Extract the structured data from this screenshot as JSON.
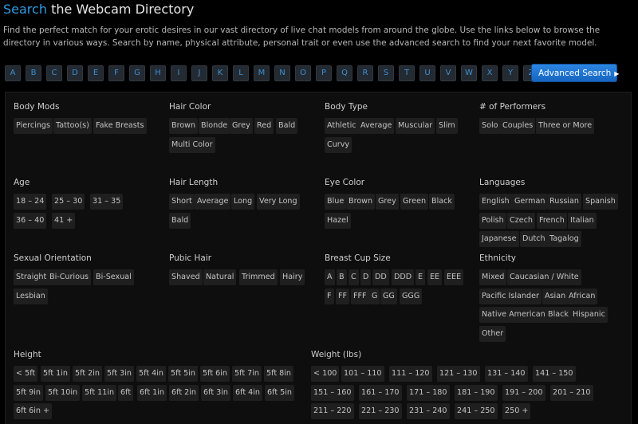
{
  "header": {
    "title_accent": "Search",
    "title_rest": "the Webcam Directory",
    "intro": "Find the perfect match for your erotic desires in our vast directory of live chat models from around the globe. Use the links below to browse the directory in various ways. Search by name, physical attribute, personal trait or even use the advanced search to find your next favorite model."
  },
  "letters": [
    "A",
    "B",
    "C",
    "D",
    "E",
    "F",
    "G",
    "H",
    "I",
    "J",
    "K",
    "L",
    "M",
    "N",
    "O",
    "P",
    "Q",
    "R",
    "S",
    "T",
    "U",
    "V",
    "W",
    "X",
    "Y",
    "Z"
  ],
  "advanced_search": {
    "label": "Advanced Search",
    "icon": "triangle-right-icon"
  },
  "categories": {
    "body_mods": {
      "title": "Body Mods",
      "tags": [
        "Piercings",
        "Tattoo(s)",
        "Fake Breasts"
      ]
    },
    "hair_color": {
      "title": "Hair Color",
      "tags": [
        "Brown",
        "Blonde",
        "Grey",
        "Red",
        "Bald",
        "Multi Color"
      ]
    },
    "body_type": {
      "title": "Body Type",
      "tags": [
        "Athletic",
        "Average",
        "Muscular",
        "Slim",
        "Curvy"
      ]
    },
    "performers": {
      "title": "# of Performers",
      "tags": [
        "Solo",
        "Couples",
        "Three or More"
      ]
    },
    "age": {
      "title": "Age",
      "tags": [
        "18 – 24",
        "25 – 30",
        "31 – 35",
        "36 – 40",
        "41 +"
      ]
    },
    "hair_length": {
      "title": "Hair Length",
      "tags": [
        "Short",
        "Average",
        "Long",
        "Very Long",
        "Bald"
      ]
    },
    "eye_color": {
      "title": "Eye Color",
      "tags": [
        "Blue",
        "Brown",
        "Grey",
        "Green",
        "Black",
        "Hazel"
      ]
    },
    "languages": {
      "title": "Languages",
      "tags": [
        "English",
        "German",
        "Russian",
        "Spanish",
        "Polish",
        "Czech",
        "French",
        "Italian",
        "Japanese",
        "Dutch",
        "Tagalog"
      ]
    },
    "sexual_orientation": {
      "title": "Sexual Orientation",
      "tags": [
        "Straight",
        "Bi-Curious",
        "Bi-Sexual",
        "Lesbian"
      ]
    },
    "pubic_hair": {
      "title": "Pubic Hair",
      "tags": [
        "Shaved",
        "Natural",
        "Trimmed",
        "Hairy"
      ]
    },
    "breast_cup": {
      "title": "Breast Cup Size",
      "tags": [
        "A",
        "B",
        "C",
        "D",
        "DD",
        "DDD",
        "E",
        "EE",
        "EEE",
        "F",
        "FF",
        "FFF",
        "G",
        "GG",
        "GGG"
      ]
    },
    "ethnicity": {
      "title": "Ethnicity",
      "tags": [
        "Mixed",
        "Caucasian / White",
        "Pacific Islander",
        "Asian",
        "African",
        "Native American",
        "Black",
        "Hispanic",
        "Other"
      ]
    },
    "height": {
      "title": "Height",
      "tags": [
        "< 5ft",
        "5ft 1in",
        "5ft 2in",
        "5ft 3in",
        "5ft 4in",
        "5ft 5in",
        "5ft 6in",
        "5ft 7in",
        "5ft 8in",
        "5ft 9in",
        "5ft 10in",
        "5ft 11in",
        "6ft",
        "6ft 1in",
        "6ft 2in",
        "6ft 3in",
        "6ft 4in",
        "6ft 5in",
        "6ft 6in +"
      ]
    },
    "weight": {
      "title": "Weight (lbs)",
      "tags": [
        "< 100",
        "101 – 110",
        "111 – 120",
        "121 – 130",
        "131 – 140",
        "141 – 150",
        "151 – 160",
        "161 – 170",
        "171 – 180",
        "181 – 190",
        "191 – 200",
        "201 – 210",
        "211 – 220",
        "221 – 230",
        "231 – 240",
        "241 – 250",
        "250 +"
      ]
    }
  }
}
